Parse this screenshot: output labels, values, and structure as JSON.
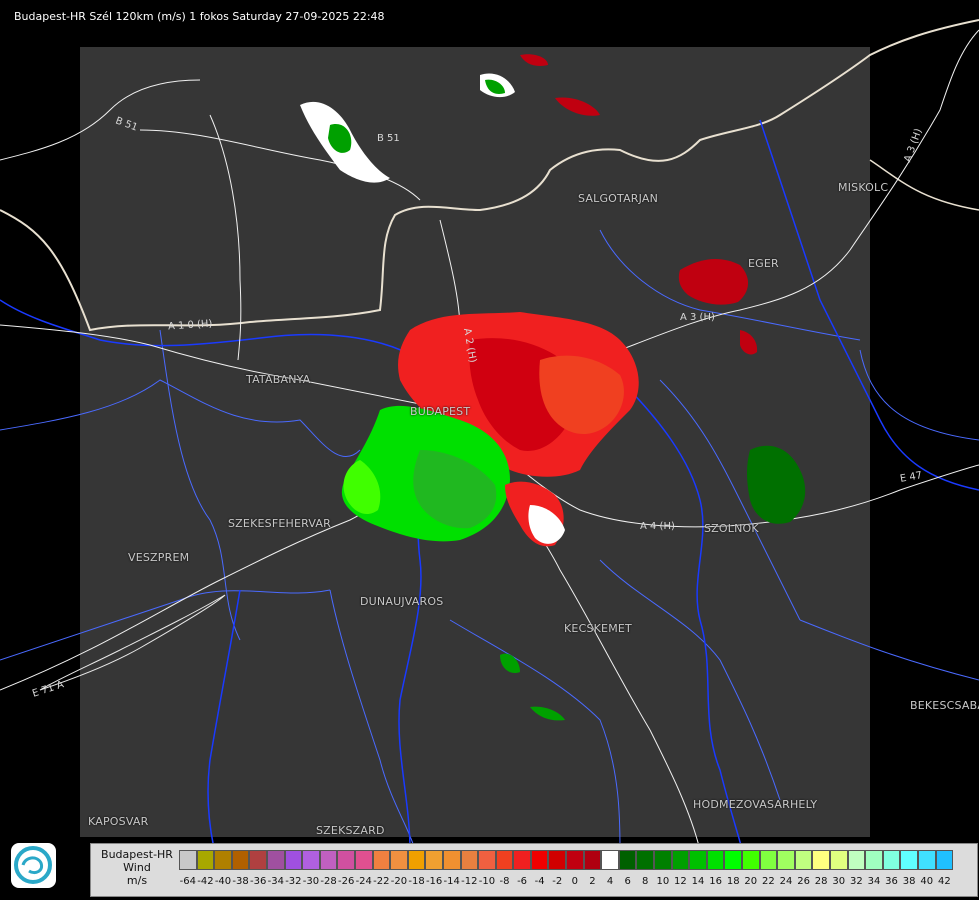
{
  "header": {
    "title": "Budapest-HR Szél 120km (m/s) 1 fokos Saturday 27-09-2025 22:48"
  },
  "cities": [
    {
      "name": "SALGOTARJAN",
      "key": "salgotarjan"
    },
    {
      "name": "MISKOLC",
      "key": "miskolc"
    },
    {
      "name": "EGER",
      "key": "eger"
    },
    {
      "name": "TATABANYA",
      "key": "tatabanya"
    },
    {
      "name": "BUDAPEST",
      "key": "budapest"
    },
    {
      "name": "SZEKESFEHERVAR",
      "key": "szekesfehervar"
    },
    {
      "name": "VESZPREM",
      "key": "veszprem"
    },
    {
      "name": "DUNAUJVAROS",
      "key": "dunaujvaros"
    },
    {
      "name": "KECSKEMET",
      "key": "kecskemet"
    },
    {
      "name": "SZOLNOK",
      "key": "szolnok"
    },
    {
      "name": "BEKESCSABA",
      "key": "bekescsaba"
    },
    {
      "name": "HODMEZOVASARHELY",
      "key": "hodmezovasarhely"
    },
    {
      "name": "KAPOSVAR",
      "key": "kaposvar"
    },
    {
      "name": "SZEKSZARD",
      "key": "szekszard"
    }
  ],
  "roads": [
    {
      "label": "B 51",
      "key": "b51a"
    },
    {
      "label": "B 51",
      "key": "b51b"
    },
    {
      "label": "A 1 0 (H)",
      "key": "a10"
    },
    {
      "label": "A 3 (H)",
      "key": "a3a"
    },
    {
      "label": "A 3 (H)",
      "key": "a3b"
    },
    {
      "label": "A 4 (H)",
      "key": "a4"
    },
    {
      "label": "E 47",
      "key": "e47"
    },
    {
      "label": "E 71 A",
      "key": "e71"
    },
    {
      "label": "A 2 (H)",
      "key": "a2"
    }
  ],
  "legend": {
    "title_line1": "Budapest-HR",
    "title_line2": "Wind",
    "title_line3": "m/s",
    "colors": [
      "#c8c8c8",
      "#a8a800",
      "#b08000",
      "#b06000",
      "#b04040",
      "#a050a0",
      "#a050e0",
      "#b060e0",
      "#c060c0",
      "#d050a0",
      "#e05090",
      "#f08040",
      "#f09040",
      "#f0a000",
      "#f0a030",
      "#f09030",
      "#e88040",
      "#f06040",
      "#f04020",
      "#f02020",
      "#f00000",
      "#d00000",
      "#c00010",
      "#b00010",
      "#ffffff",
      "#006000",
      "#007000",
      "#008000",
      "#00a000",
      "#00c000",
      "#00e000",
      "#00ff00",
      "#40ff00",
      "#80ff40",
      "#a0ff60",
      "#c0ff80",
      "#ffff80",
      "#e0ff80",
      "#c0ffc0",
      "#a0ffc0",
      "#80ffe0",
      "#60ffff",
      "#40e0ff",
      "#20c0ff",
      "#0090ff",
      "#0060ff",
      "#0030ff",
      "#0000ff"
    ],
    "ticks": [
      "-64",
      "-42",
      "-40",
      "-38",
      "-36",
      "-34",
      "-32",
      "-30",
      "-28",
      "-26",
      "-24",
      "-22",
      "-20",
      "-18",
      "-16",
      "-14",
      "-12",
      "-10",
      "-8",
      "-6",
      "-4",
      "-2",
      "0",
      "2",
      "4",
      "6",
      "8",
      "10",
      "12",
      "14",
      "16",
      "18",
      "20",
      "22",
      "24",
      "26",
      "28",
      "30",
      "32",
      "34",
      "36",
      "38",
      "40",
      "42"
    ]
  },
  "colors": {
    "background": "#000000",
    "radar_area": "#363636",
    "border_line": "#e8e8e8",
    "river": "#1a3aff",
    "road": "#ffffff"
  }
}
